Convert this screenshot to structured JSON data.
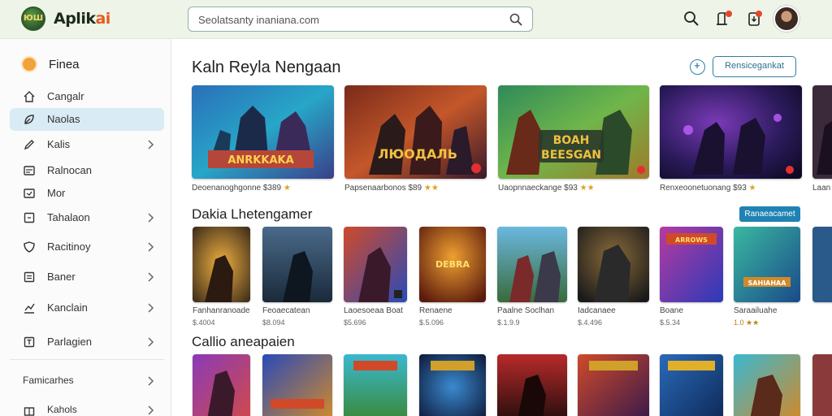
{
  "header": {
    "logo_badge": "ЮШ",
    "logo_text": "Aplik",
    "logo_accent": "ai",
    "search_value": "Seolatsanty inaniana.com",
    "icons": [
      "search-icon",
      "notification-icon",
      "download-icon",
      "user-avatar"
    ]
  },
  "sidebar": {
    "head": "Finea",
    "items": [
      {
        "label": "Cangalr",
        "icon": "home-icon",
        "chevron": false,
        "active": false
      },
      {
        "label": "Naolas",
        "icon": "leaf-icon",
        "chevron": false,
        "active": true
      },
      {
        "label": "Kalis",
        "icon": "pen-icon",
        "chevron": true,
        "active": false
      },
      {
        "label": "Ralnocan",
        "icon": "card-icon",
        "chevron": false,
        "active": false
      },
      {
        "label": "Mor",
        "icon": "gamepad-icon",
        "chevron": false,
        "active": false
      },
      {
        "label": "Tahalaon",
        "icon": "box-icon",
        "chevron": true,
        "active": false
      },
      {
        "label": "Racitinoy",
        "icon": "shield-icon",
        "chevron": true,
        "active": false
      },
      {
        "label": "Baner",
        "icon": "list-icon",
        "chevron": true,
        "active": false
      },
      {
        "label": "Kanclain",
        "icon": "chart-icon",
        "chevron": true,
        "active": false
      },
      {
        "label": "Parlagien",
        "icon": "square-t-icon",
        "chevron": true,
        "active": false
      }
    ],
    "footer_items": [
      {
        "label": "Famicarhes"
      },
      {
        "label": "Kahols"
      }
    ]
  },
  "featured": {
    "title": "Kaln Reyla Nengaan",
    "button": "Rensicegankat",
    "cards": [
      {
        "caption": "Deoenanoghgonne $389",
        "stars": "★"
      },
      {
        "caption": "Papsenaarbonos $89",
        "stars": "★★"
      },
      {
        "caption": "Uaopnnaeckange $93",
        "stars": "★★"
      },
      {
        "caption": "Renxeoonetuonang $93",
        "stars": "★"
      },
      {
        "caption": "Laan",
        "stars": ""
      }
    ]
  },
  "popular": {
    "title": "Dakia Lhetengamer",
    "button": "Ranaeacamet",
    "cards": [
      {
        "name": "Fanhanranoade",
        "price": "$.4004"
      },
      {
        "name": "Feoaecatean",
        "price": "$8.094"
      },
      {
        "name": "Laoesoeaa Boat",
        "price": "$5.696"
      },
      {
        "name": "Renaene",
        "price": "$.5.096"
      },
      {
        "name": "Paalne Soclhan",
        "price": "$.1.9.9"
      },
      {
        "name": "Iadcanaee",
        "price": "$.4.496"
      },
      {
        "name": "Boane",
        "price": "$.5.34"
      },
      {
        "name": "Saraailuahe",
        "price": "1.0 ★★"
      },
      {
        "name": "",
        "price": ""
      }
    ]
  },
  "recent": {
    "title": "Callio aneapaien"
  },
  "colors": {
    "accent": "#2f7fa5",
    "active_nav": "#d9ebf5",
    "header_bg": "#eef4e8"
  }
}
